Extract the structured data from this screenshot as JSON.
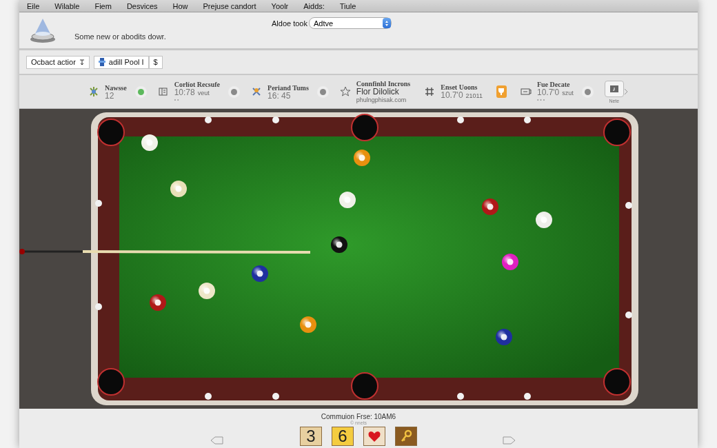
{
  "menu": [
    "Eile",
    "Wilable",
    "Fiem",
    "Desvices",
    "How",
    "Prejuse candort",
    "Yoolr",
    "Aidds:",
    "Tiule"
  ],
  "header": {
    "subtitle": "Some new or abodits dowr.",
    "select_label": "Aldoe took",
    "select_value": "Adtve"
  },
  "toolbar": {
    "action_button": "Ocbact actior",
    "pool_button": "adill Pool I",
    "price_button": "$"
  },
  "stats": [
    {
      "kind": "stat",
      "title": "Nawsse",
      "value": "12",
      "color": "#5cb85c"
    },
    {
      "kind": "stat",
      "title": "Corlíot Recsufe",
      "value": "10:78",
      "suffix": "veut",
      "dots": "• •",
      "color": "#8a8a8a"
    },
    {
      "kind": "stat",
      "title": "Periand Tums",
      "value": "16: 45",
      "color": "#8a8a8a"
    },
    {
      "kind": "link",
      "title": "Connfinhl Incrons",
      "value": "Flor Dilolick",
      "suffix": "phulngphisak.com"
    },
    {
      "kind": "stat",
      "title": "Enset Uoons",
      "value": "10.7'0",
      "suffix": "21011"
    },
    {
      "kind": "badge"
    },
    {
      "kind": "stat",
      "title": "Fue Decate",
      "value": "10.7'0",
      "suffix": "szut",
      "dots": "• • •",
      "color": "#8a8a8a"
    },
    {
      "kind": "button",
      "title": "Nete"
    }
  ],
  "footer": {
    "title": "Commuion Frse: 10AM6",
    "subtitle": "© nnets",
    "tiles": [
      {
        "kind": "number",
        "text": "3"
      },
      {
        "kind": "number",
        "text": "6"
      },
      {
        "kind": "heart"
      },
      {
        "kind": "key"
      }
    ]
  }
}
